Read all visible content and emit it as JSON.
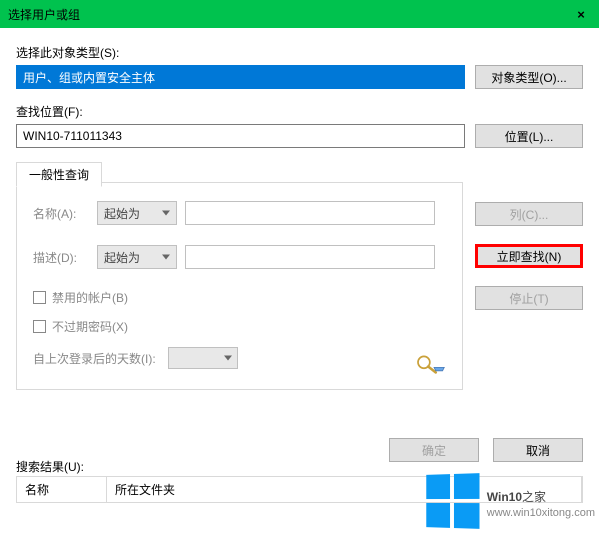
{
  "window": {
    "title": "选择用户或组",
    "close": "×"
  },
  "objectType": {
    "label": "选择此对象类型(S):",
    "value": "用户、组或内置安全主体",
    "button": "对象类型(O)..."
  },
  "location": {
    "label": "查找位置(F):",
    "value": "WIN10-711011343",
    "button": "位置(L)..."
  },
  "tab": {
    "label": "一般性查询"
  },
  "query": {
    "nameLabel": "名称(A):",
    "nameMode": "起始为",
    "descLabel": "描述(D):",
    "descMode": "起始为",
    "cbDisabled": "禁用的帐户(B)",
    "cbNoExpire": "不过期密码(X)",
    "daysLabel": "自上次登录后的天数(I):"
  },
  "sideButtons": {
    "columns": "列(C)...",
    "findNow": "立即查找(N)",
    "stop": "停止(T)"
  },
  "dialog": {
    "ok": "确定",
    "cancel": "取消"
  },
  "results": {
    "label": "搜索结果(U):",
    "colName": "名称",
    "colFolder": "所在文件夹"
  },
  "watermark": {
    "brand1": "Win10",
    "brand2": "之家",
    "url": "www.win10xitong.com"
  }
}
